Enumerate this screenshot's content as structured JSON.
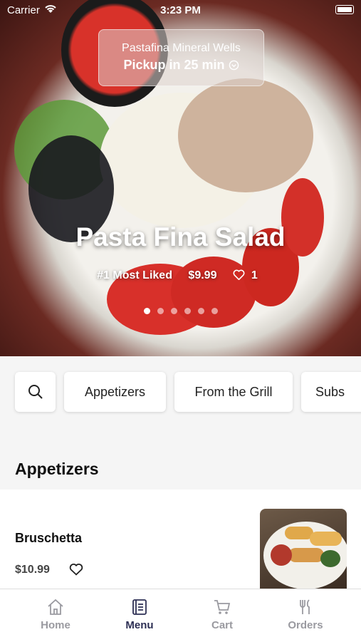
{
  "status": {
    "carrier": "Carrier",
    "time": "3:23 PM"
  },
  "pickup": {
    "location": "Pastafina Mineral Wells",
    "time_label": "Pickup in 25 min"
  },
  "hero": {
    "title": "Pasta Fina Salad",
    "rank": "#1 Most Liked",
    "price": "$9.99",
    "likes": "1",
    "page_count": 6,
    "active_page": 1
  },
  "categories": [
    "Appetizers",
    "From the Grill",
    "Subs"
  ],
  "section": {
    "title": "Appetizers"
  },
  "item": {
    "name": "Bruschetta",
    "price": "$10.99"
  },
  "tabs": [
    "Home",
    "Menu",
    "Cart",
    "Orders"
  ],
  "colors": {
    "active_tab": "#2d2f54",
    "inactive_tab": "#9a9aa0"
  }
}
